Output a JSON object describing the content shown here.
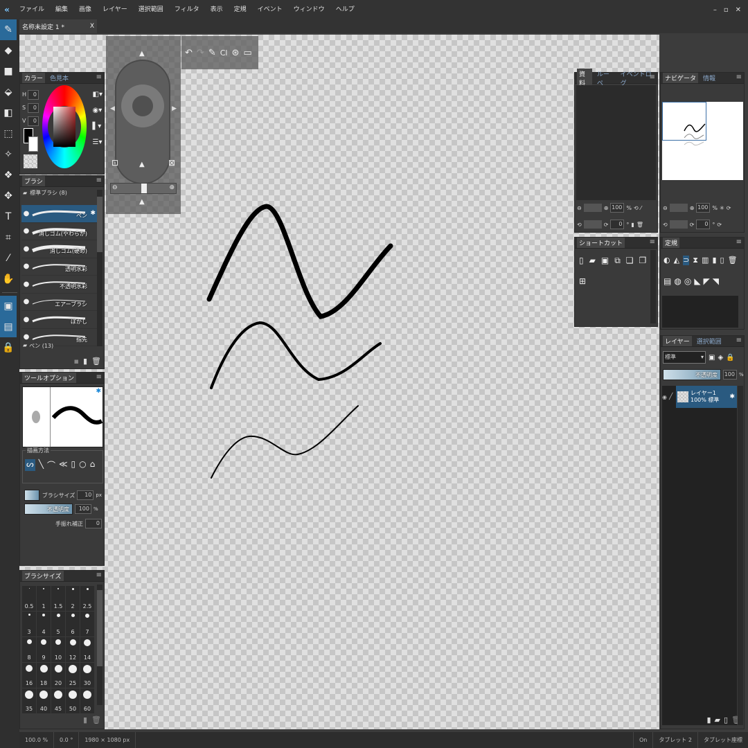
{
  "app": {
    "logo": "krita-logo",
    "doc_tab": "名称未設定 1 *",
    "doc_close": "X"
  },
  "menu": [
    "ファイル",
    "編集",
    "画像",
    "レイヤー",
    "選択範囲",
    "フィルタ",
    "表示",
    "定規",
    "イベント",
    "ウィンドウ",
    "ヘルプ"
  ],
  "window_controls": [
    "–",
    "▫",
    "✕"
  ],
  "color_panel": {
    "tabs": [
      "カラー",
      "色見本"
    ],
    "hsv": [
      {
        "label": "H",
        "value": "0"
      },
      {
        "label": "S",
        "value": "0"
      },
      {
        "label": "V",
        "value": "0"
      }
    ]
  },
  "brush_panel": {
    "title": "ブラシ",
    "group_label": "標準ブラシ (8)",
    "brushes": [
      "ペン",
      "消しゴム(やわらか)",
      "消しゴム(硬め)",
      "透明水彩",
      "不透明水彩",
      "エアーブラシ",
      "ぼかし",
      "指先"
    ],
    "next_group": "ペン (13)"
  },
  "tool_options": {
    "title": "ツールオプション",
    "draw_method_label": "描画方法",
    "brush_size_label": "ブラシサイズ",
    "brush_size": "10",
    "brush_size_unit": "px",
    "opacity_label": "不透明度",
    "opacity": "100",
    "opacity_unit": "%",
    "stabilizer_label": "手振れ補正",
    "stabilizer": "0"
  },
  "brush_size_panel": {
    "title": "ブラシサイズ",
    "sizes": [
      "0.5",
      "1",
      "1.5",
      "2",
      "2.5",
      "3",
      "4",
      "5",
      "6",
      "7",
      "8",
      "9",
      "10",
      "12",
      "14",
      "16",
      "18",
      "20",
      "25",
      "30",
      "35",
      "40",
      "45",
      "50",
      "60"
    ]
  },
  "resources_panel": {
    "tabs": [
      "資料",
      "ルーペ",
      "イベントログ"
    ],
    "zoom": "100",
    "zoom_unit": "%",
    "rotation": "0",
    "rotation_unit": "°"
  },
  "navigator_panel": {
    "tabs": [
      "ナビゲータ",
      "情報"
    ],
    "zoom": "100",
    "zoom_unit": "%",
    "rotation": "0",
    "rotation_unit": "°"
  },
  "shortcut_panel": {
    "title": "ショートカット"
  },
  "ruler_panel": {
    "title": "定規"
  },
  "layer_panel": {
    "tabs": [
      "レイヤー",
      "選択範囲"
    ],
    "blend_mode": "標準",
    "opacity_label": "不透明度",
    "opacity": "100",
    "opacity_unit": "%",
    "layer_name": "レイヤー1",
    "layer_info": "100% 標準"
  },
  "status": {
    "zoom": "100.0 %",
    "rotation": "0.0 °",
    "size": "1980 × 1080 px",
    "on": "On",
    "tablet": "タブレット 2",
    "tablet_coord": "タブレット座標"
  },
  "colors": {
    "accent": "#2a6a9a",
    "panel": "#3a3a3a",
    "title": "#2f2f2f"
  }
}
